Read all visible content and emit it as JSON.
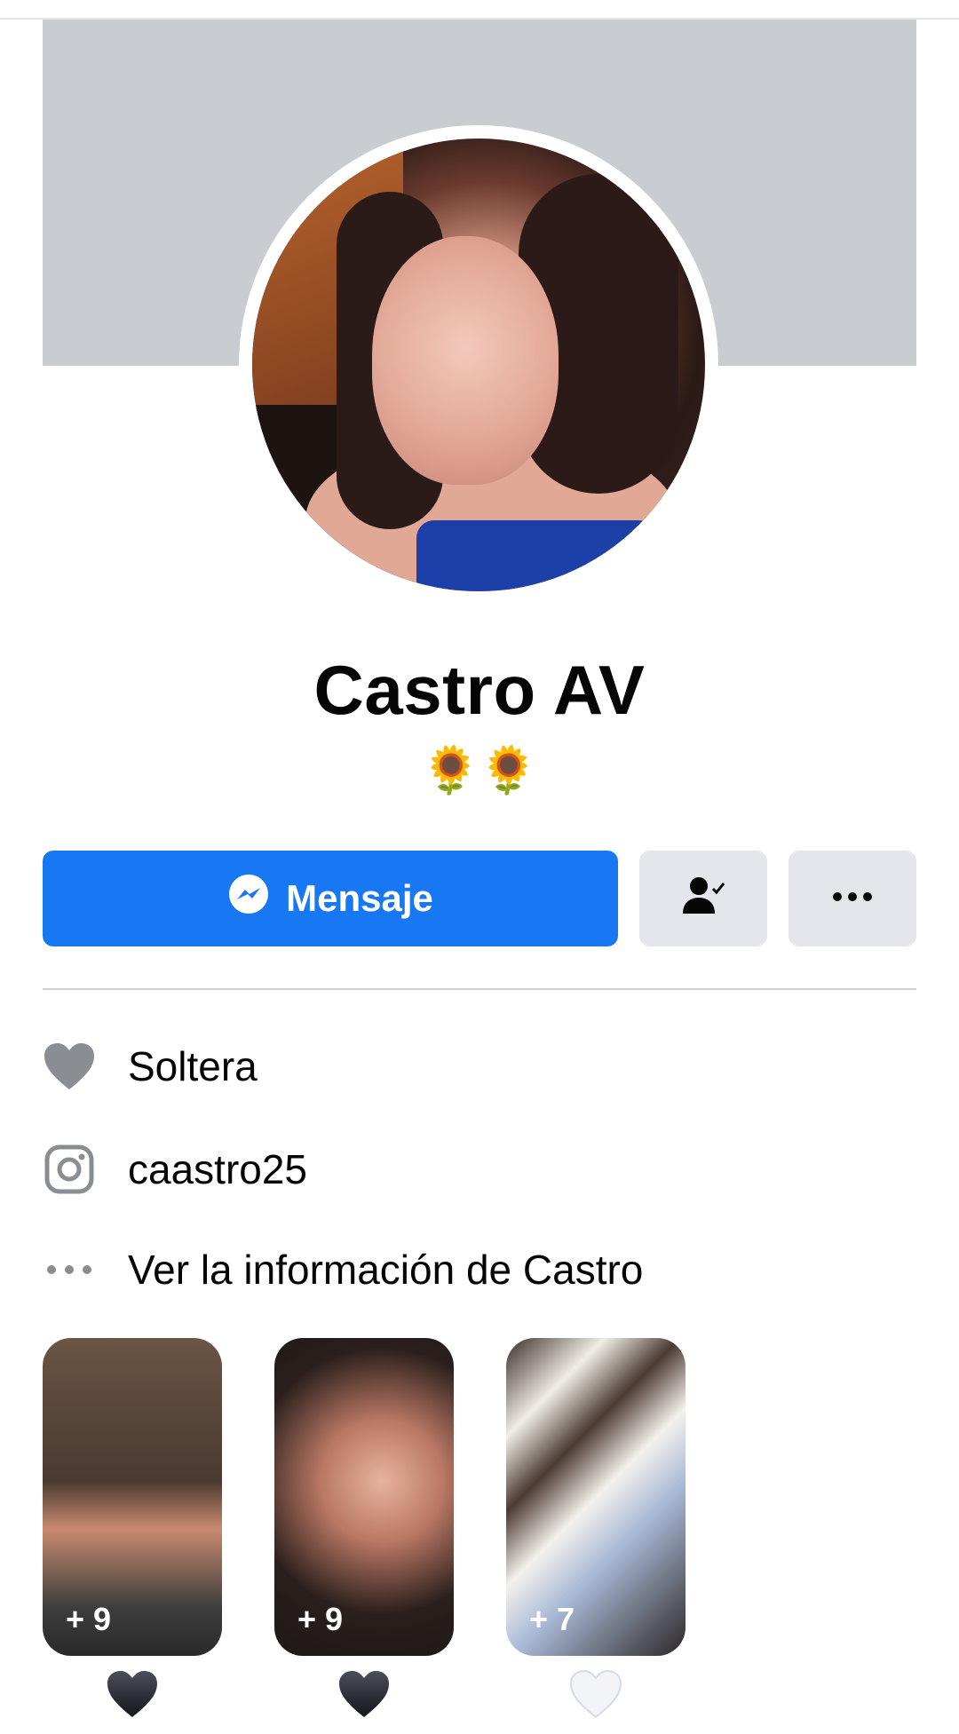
{
  "profile": {
    "name": "Castro AV",
    "bio": "🌻🌻"
  },
  "actions": {
    "message_label": "Mensaje",
    "friend_icon": "friends-check-icon",
    "more_icon": "more-horizontal-icon"
  },
  "info": {
    "items": [
      {
        "icon": "heart-icon",
        "label": "Soltera"
      },
      {
        "icon": "instagram-icon",
        "label": "caastro25"
      },
      {
        "icon": "more-dots-icon",
        "label": "Ver la información de Castro"
      }
    ]
  },
  "featured": {
    "items": [
      {
        "count": "+ 9",
        "heart": "black-heart"
      },
      {
        "count": "+ 9",
        "heart": "black-heart"
      },
      {
        "count": "+ 7",
        "heart": "white-heart"
      }
    ]
  },
  "colors": {
    "accent": "#1877f2",
    "button_gray": "#e4e6eb",
    "cover_gray": "#c9ccd1",
    "icon_gray": "#8a8d91"
  }
}
